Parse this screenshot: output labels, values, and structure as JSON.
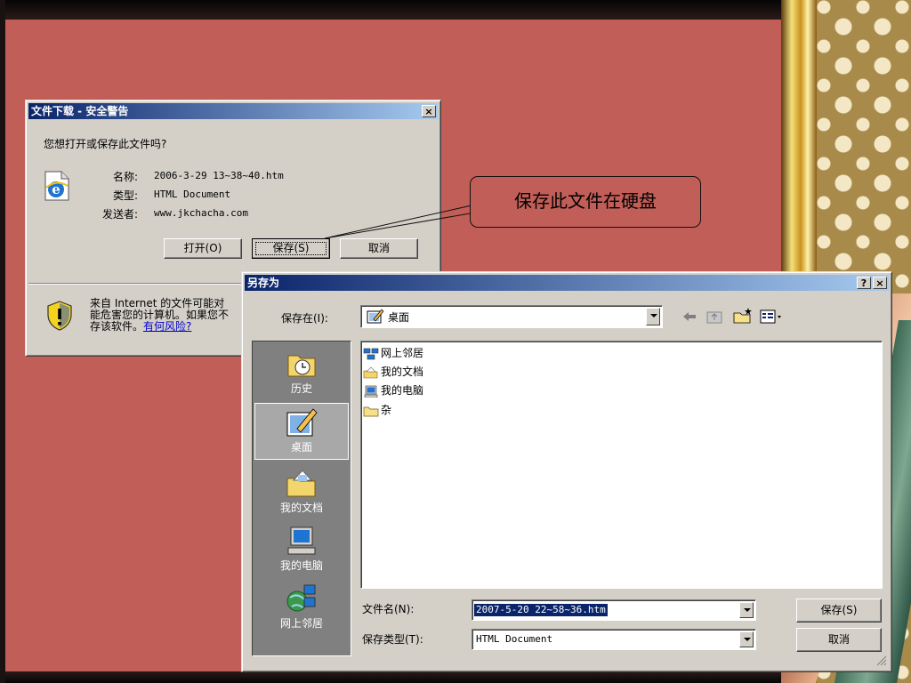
{
  "download_dialog": {
    "title": "文件下载 - 安全警告",
    "question": "您想打开或保存此文件吗?",
    "name_label": "名称:",
    "name_value": "2006-3-29 13~38~40.htm",
    "type_label": "类型:",
    "type_value": "HTML Document",
    "sender_label": "发送者:",
    "sender_value": "www.jkchacha.com",
    "open_button": "打开(O)",
    "save_button": "保存(S)",
    "cancel_button": "取消",
    "warning_line1": "来自 Internet 的文件可能对",
    "warning_line2": "能危害您的计算机。如果您不",
    "warning_line3": "存该软件。",
    "risk_link": "有何风险?",
    "close_glyph": "×"
  },
  "callout": {
    "text": "保存此文件在硬盘"
  },
  "saveas_dialog": {
    "title": "另存为",
    "help_glyph": "?",
    "close_glyph": "×",
    "save_in_label": "保存在(I):",
    "save_in_value": "桌面",
    "places": [
      {
        "label": "历史"
      },
      {
        "label": "桌面"
      },
      {
        "label": "我的文档"
      },
      {
        "label": "我的电脑"
      },
      {
        "label": "网上邻居"
      }
    ],
    "files": [
      {
        "label": "网上邻居"
      },
      {
        "label": "我的文档"
      },
      {
        "label": "我的电脑"
      },
      {
        "label": "杂"
      }
    ],
    "filename_label": "文件名(N):",
    "filename_value": "2007-5-20 22~58~36.htm",
    "filetype_label": "保存类型(T):",
    "filetype_value": "HTML Document",
    "save_button": "保存(S)",
    "cancel_button": "取消"
  },
  "colors": {
    "slide_bg": "#c25e58",
    "titlebar_start": "#0a246a",
    "titlebar_end": "#a6caf0",
    "dialog_face": "#d4d0c8",
    "places_bar": "#808080",
    "selection": "#0a246a"
  }
}
